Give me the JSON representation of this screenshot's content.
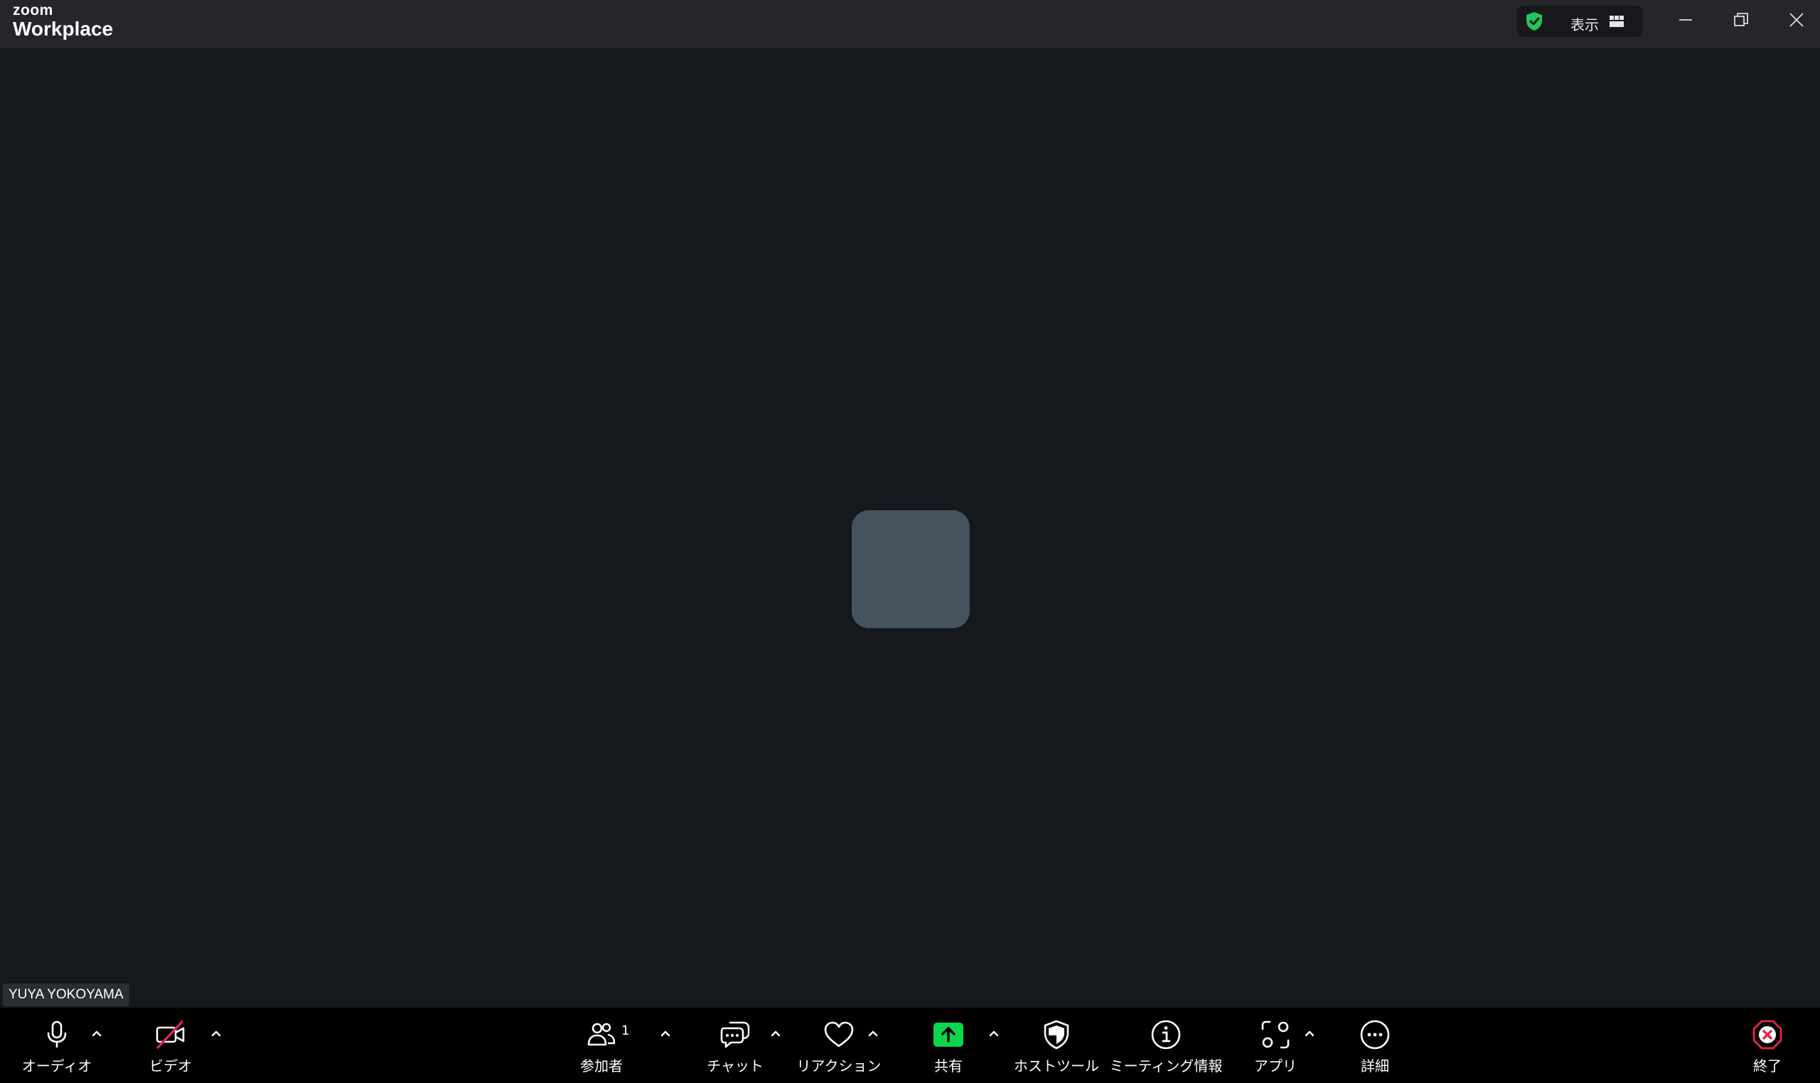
{
  "titlebar": {
    "logo_small": "zoom",
    "logo_big": "Workplace",
    "view_label": "表示"
  },
  "video": {
    "participant_name": "YUYA YOKOYAMA"
  },
  "toolbar": {
    "audio_label": "オーディオ",
    "video_label": "ビデオ",
    "participants_label": "参加者",
    "participants_count": "1",
    "chat_label": "チャット",
    "reactions_label": "リアクション",
    "share_label": "共有",
    "host_tools_label": "ホストツール",
    "meeting_info_label": "ミーティング情報",
    "apps_label": "アプリ",
    "more_label": "詳細",
    "end_label": "終了"
  },
  "colors": {
    "share_green": "#0bd64e",
    "shield_green": "#22c55e",
    "end_red": "#e5254b",
    "video_off_red": "#e5254b",
    "avatar": "#44535e"
  }
}
